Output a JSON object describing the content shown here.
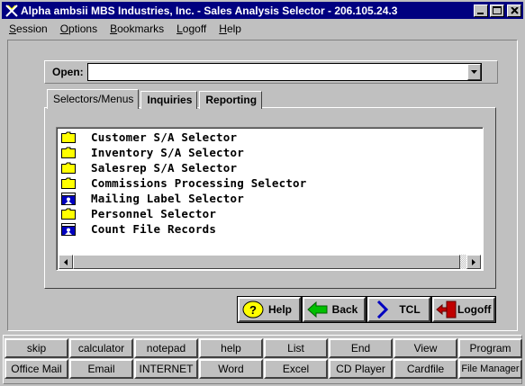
{
  "window": {
    "title": "Alpha ambsii MBS Industries, Inc. - Sales Analysis Selector - 206.105.24.3"
  },
  "menu": [
    {
      "pre": "",
      "ul": "S",
      "post": "ession"
    },
    {
      "pre": "",
      "ul": "O",
      "post": "ptions"
    },
    {
      "pre": "",
      "ul": "B",
      "post": "ookmarks"
    },
    {
      "pre": "",
      "ul": "L",
      "post": "ogoff"
    },
    {
      "pre": "",
      "ul": "H",
      "post": "elp"
    }
  ],
  "open": {
    "label": "Open:",
    "value": ""
  },
  "tabs": [
    "Selectors/Menus",
    "Inquiries",
    "Reporting"
  ],
  "list": [
    {
      "label": "Customer S/A Selector",
      "icon": "folder-icon"
    },
    {
      "label": "Inventory S/A Selector",
      "icon": "folder-icon"
    },
    {
      "label": "Salesrep S/A Selector",
      "icon": "folder-icon"
    },
    {
      "label": "Commissions Processing Selector",
      "icon": "folder-icon"
    },
    {
      "label": "Mailing Label Selector",
      "icon": "program-icon"
    },
    {
      "label": "Personnel Selector",
      "icon": "folder-icon"
    },
    {
      "label": "Count File Records",
      "icon": "program-icon"
    }
  ],
  "nav": {
    "help": "Help",
    "back": "Back",
    "tcl": "TCL",
    "logoff": "Logoff"
  },
  "toolbar": {
    "row1": [
      "skip",
      "calculator",
      "notepad",
      "help",
      "List",
      "End",
      "View",
      "Program"
    ],
    "row2": [
      "Office Mail",
      "Email",
      "INTERNET",
      "Word",
      "Excel",
      "CD Player",
      "Cardfile",
      "File Manager"
    ]
  },
  "colors": {
    "titlebar": "#000080",
    "face": "#c0c0c0",
    "folder": "#ffff00",
    "back_arrow": "#00c000",
    "tcl_chevron": "#0000c0",
    "logoff_door": "#c00000"
  }
}
